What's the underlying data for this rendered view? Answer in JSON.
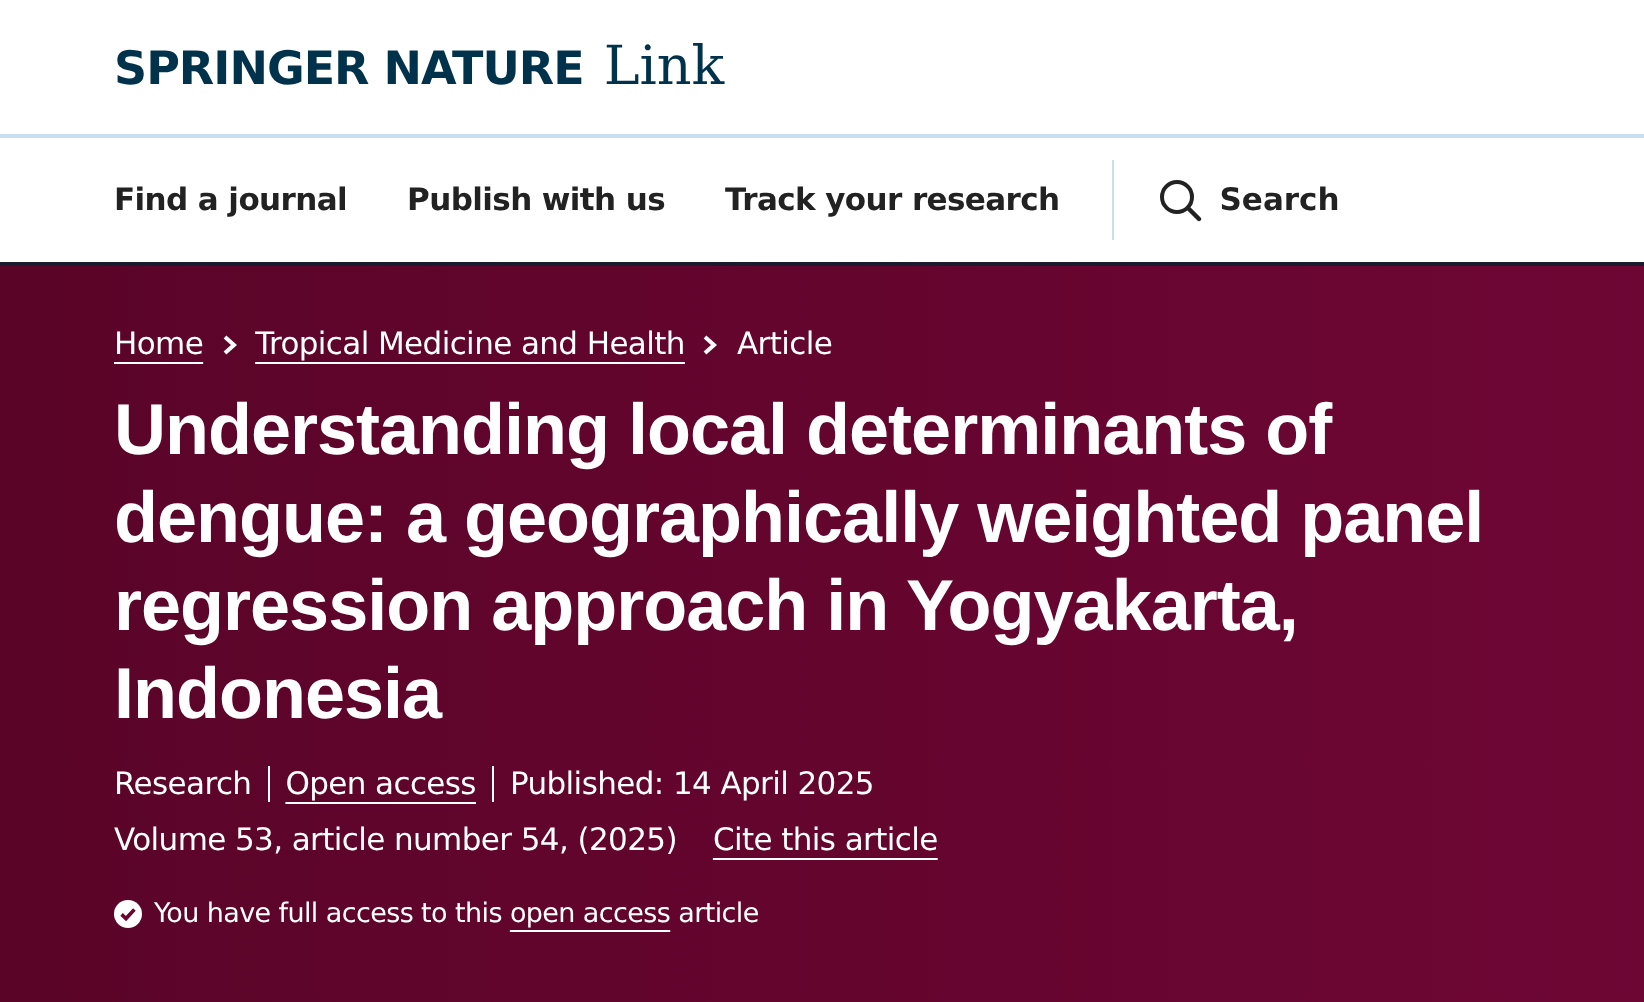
{
  "logo": {
    "brand": "SPRINGER NATURE",
    "product": "Link"
  },
  "nav": {
    "items": [
      "Find a journal",
      "Publish with us",
      "Track your research"
    ],
    "search": "Search"
  },
  "breadcrumbs": [
    {
      "label": "Home",
      "kind": "link"
    },
    {
      "label": "Tropical Medicine and Health",
      "kind": "link"
    },
    {
      "label": "Article",
      "kind": "current"
    }
  ],
  "title": "Understanding local determinants of dengue: a geographically weighted panel regression approach in Yogyakarta, Indonesia",
  "meta": [
    {
      "label": "Research",
      "kind": "text"
    },
    {
      "label": "Open access",
      "kind": "link"
    },
    {
      "label": "Published: 14 April 2025",
      "kind": "text"
    }
  ],
  "citation": {
    "text": "Volume 53, article number 54, (2025)",
    "link": "Cite this article"
  },
  "access": {
    "before": "You have full access to this",
    "link": "open access",
    "after": "article"
  }
}
